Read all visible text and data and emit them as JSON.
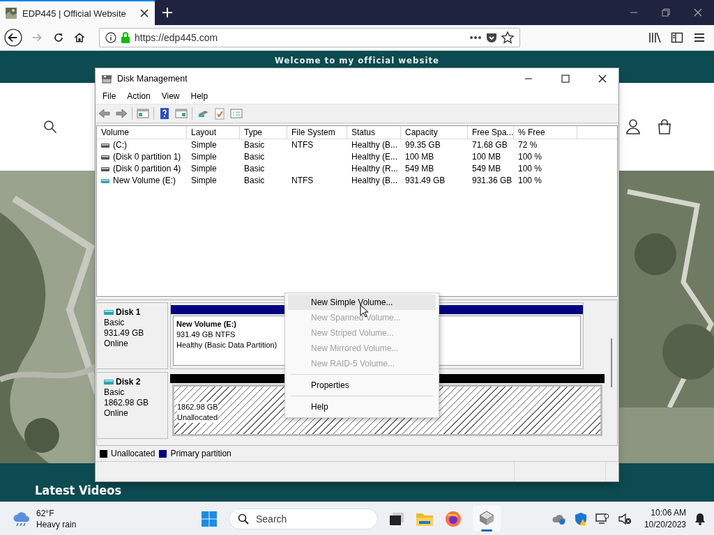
{
  "browser": {
    "tab_title": "EDP445 | Official Website",
    "url": "https://edp445.com"
  },
  "website": {
    "banner": "Welcome to my official website",
    "section_heading": "Latest Videos"
  },
  "window": {
    "title": "Disk Management",
    "menu": [
      "File",
      "Action",
      "View",
      "Help"
    ],
    "columns": [
      "Volume",
      "Layout",
      "Type",
      "File System",
      "Status",
      "Capacity",
      "Free Spa...",
      "% Free"
    ],
    "rows": [
      {
        "kind": "internal",
        "cells": [
          "(C:)",
          "Simple",
          "Basic",
          "NTFS",
          "Healthy (B...",
          "99.35 GB",
          "71.68 GB",
          "72 %"
        ]
      },
      {
        "kind": "internal",
        "cells": [
          "(Disk 0 partition 1)",
          "Simple",
          "Basic",
          "",
          "Healthy (E...",
          "100 MB",
          "100 MB",
          "100 %"
        ]
      },
      {
        "kind": "internal",
        "cells": [
          "(Disk 0 partition 4)",
          "Simple",
          "Basic",
          "",
          "Healthy (R...",
          "549 MB",
          "549 MB",
          "100 %"
        ]
      },
      {
        "kind": "external",
        "cells": [
          "New Volume (E:)",
          "Simple",
          "Basic",
          "NTFS",
          "Healthy (B...",
          "931.49 GB",
          "931.36 GB",
          "100 %"
        ]
      }
    ],
    "disks": [
      {
        "name": "Disk 1",
        "type": "Basic",
        "size": "931.49 GB",
        "status": "Online",
        "partition": {
          "kind": "primary",
          "title": "New Volume  (E:)",
          "lines": [
            "931.49 GB NTFS",
            "Healthy (Basic Data Partition)"
          ]
        }
      },
      {
        "name": "Disk 2",
        "type": "Basic",
        "size": "1862.98 GB",
        "status": "Online",
        "partition": {
          "kind": "unallocated",
          "lines": [
            "1862.98 GB",
            "Unallocated"
          ]
        }
      }
    ],
    "legend": [
      {
        "label": "Unallocated",
        "color": "#000000"
      },
      {
        "label": "Primary partition",
        "color": "#000080"
      }
    ]
  },
  "context_menu": [
    {
      "kind": "item",
      "label": "New Simple Volume...",
      "disabled": false,
      "selected": true
    },
    {
      "kind": "item",
      "label": "New Spanned Volume...",
      "disabled": true,
      "selected": false
    },
    {
      "kind": "item",
      "label": "New Striped Volume...",
      "disabled": true,
      "selected": false
    },
    {
      "kind": "item",
      "label": "New Mirrored Volume...",
      "disabled": true,
      "selected": false
    },
    {
      "kind": "item",
      "label": "New RAID-5 Volume...",
      "disabled": true,
      "selected": false
    },
    {
      "kind": "separator"
    },
    {
      "kind": "item",
      "label": "Properties",
      "disabled": false,
      "selected": false
    },
    {
      "kind": "separator"
    },
    {
      "kind": "item",
      "label": "Help",
      "disabled": false,
      "selected": false
    }
  ],
  "taskbar": {
    "temperature": "62°F",
    "weather": "Heavy rain",
    "search_placeholder": "Search",
    "time": "10:06 AM",
    "date": "10/20/2023"
  }
}
